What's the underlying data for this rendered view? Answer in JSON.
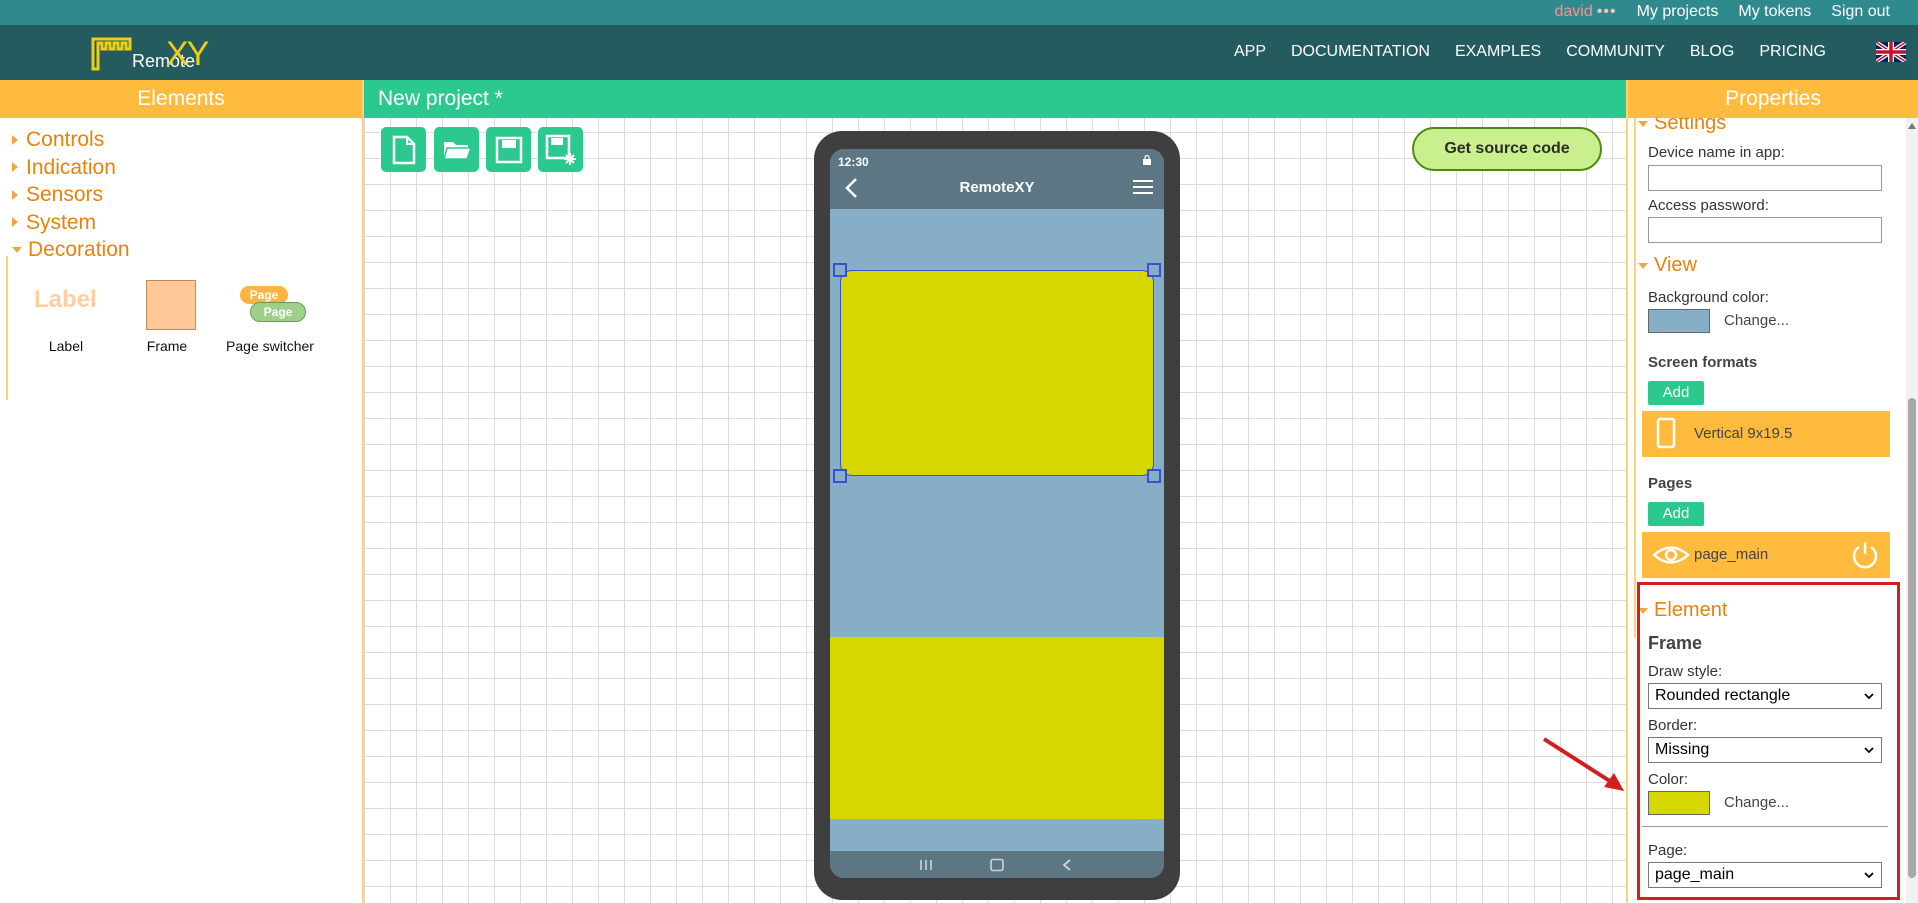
{
  "topbar": {
    "user": "david",
    "dots": "•••",
    "links": [
      "My projects",
      "My tokens",
      "Sign out"
    ]
  },
  "header": {
    "logo_text": "Remote",
    "logo_xy": "XY",
    "nav": [
      "APP",
      "DOCUMENTATION",
      "EXAMPLES",
      "COMMUNITY",
      "BLOG",
      "PRICING"
    ],
    "flag_icon": "uk-flag-icon"
  },
  "elements_panel": {
    "title": "Elements",
    "categories": [
      "Controls",
      "Indication",
      "Sensors",
      "System",
      "Decoration"
    ],
    "expanded": "Decoration",
    "decoration_items": [
      {
        "name": "Label",
        "preview": "Label"
      },
      {
        "name": "Frame",
        "preview": ""
      },
      {
        "name": "Page switcher",
        "preview": "Page"
      }
    ]
  },
  "editor": {
    "project_title": "New project *",
    "toolbar": [
      "new-file-icon",
      "open-folder-icon",
      "save-icon",
      "save-as-icon"
    ],
    "get_source_code": "Get source code",
    "phone": {
      "time": "12:30",
      "app_title": "RemoteXY",
      "background_color": "#86aec6",
      "frame_color": "#d4d700"
    }
  },
  "properties_panel": {
    "title": "Properties",
    "settings": {
      "heading": "Settings",
      "device_name_label": "Device name in app:",
      "device_name_value": "",
      "access_password_label": "Access password:",
      "access_password_value": ""
    },
    "view": {
      "heading": "View",
      "background_color_label": "Background color:",
      "background_color": "#86aec6",
      "change_label": "Change...",
      "screen_formats_label": "Screen formats",
      "add_label": "Add",
      "screen_format": "Vertical 9x19.5",
      "pages_label": "Pages",
      "page": "page_main"
    },
    "element": {
      "heading": "Element",
      "type": "Frame",
      "draw_style_label": "Draw style:",
      "draw_style_value": "Rounded rectangle",
      "border_label": "Border:",
      "border_value": "Missing",
      "color_label": "Color:",
      "color": "#d4d700",
      "change_label": "Change...",
      "page_label": "Page:",
      "page_value": "page_main"
    }
  },
  "colors": {
    "accent_orange": "#ffbb3d",
    "accent_green": "#2cc98f",
    "header_teal": "#235b5e",
    "annotation_red": "#d41e1e"
  }
}
